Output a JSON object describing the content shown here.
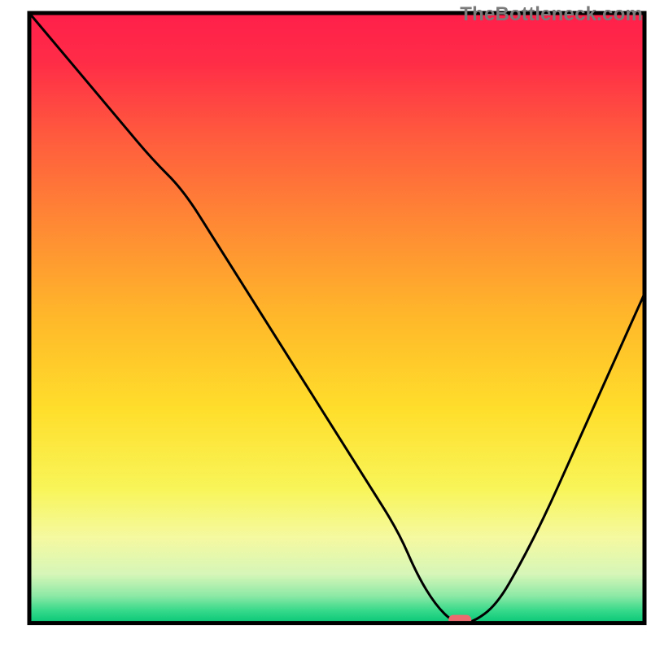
{
  "watermark": "TheBottleneck.com",
  "chart_data": {
    "type": "line",
    "title": "",
    "xlabel": "",
    "ylabel": "",
    "xlim": [
      0,
      100
    ],
    "ylim": [
      0,
      100
    ],
    "curve": {
      "name": "bottleneck-curve",
      "x": [
        0,
        5,
        10,
        15,
        20,
        25,
        30,
        35,
        40,
        45,
        50,
        55,
        60,
        63,
        66,
        69,
        72,
        76,
        80,
        84,
        88,
        92,
        96,
        100
      ],
      "y": [
        100,
        94,
        88,
        82,
        76,
        71,
        63,
        55,
        47,
        39,
        31,
        23,
        15,
        8,
        3,
        0,
        0,
        3,
        10,
        18,
        27,
        36,
        45,
        54
      ]
    },
    "marker": {
      "name": "optimum-marker",
      "x": 70,
      "y": 0,
      "color": "#ed6a6e"
    },
    "gradient_stops": [
      {
        "offset": 0.0,
        "color": "#ff1f4a"
      },
      {
        "offset": 0.08,
        "color": "#ff2c47"
      },
      {
        "offset": 0.2,
        "color": "#ff5a3e"
      },
      {
        "offset": 0.35,
        "color": "#ff8a34"
      },
      {
        "offset": 0.5,
        "color": "#ffb82a"
      },
      {
        "offset": 0.65,
        "color": "#ffde2b"
      },
      {
        "offset": 0.78,
        "color": "#f8f559"
      },
      {
        "offset": 0.86,
        "color": "#f5f9a0"
      },
      {
        "offset": 0.92,
        "color": "#d6f6b8"
      },
      {
        "offset": 0.955,
        "color": "#8ee9a6"
      },
      {
        "offset": 0.98,
        "color": "#36d98a"
      },
      {
        "offset": 1.0,
        "color": "#06c777"
      }
    ],
    "frame": {
      "xmin": 4.5,
      "xmax": 99,
      "ymin": 4.3,
      "ymax": 98
    }
  }
}
